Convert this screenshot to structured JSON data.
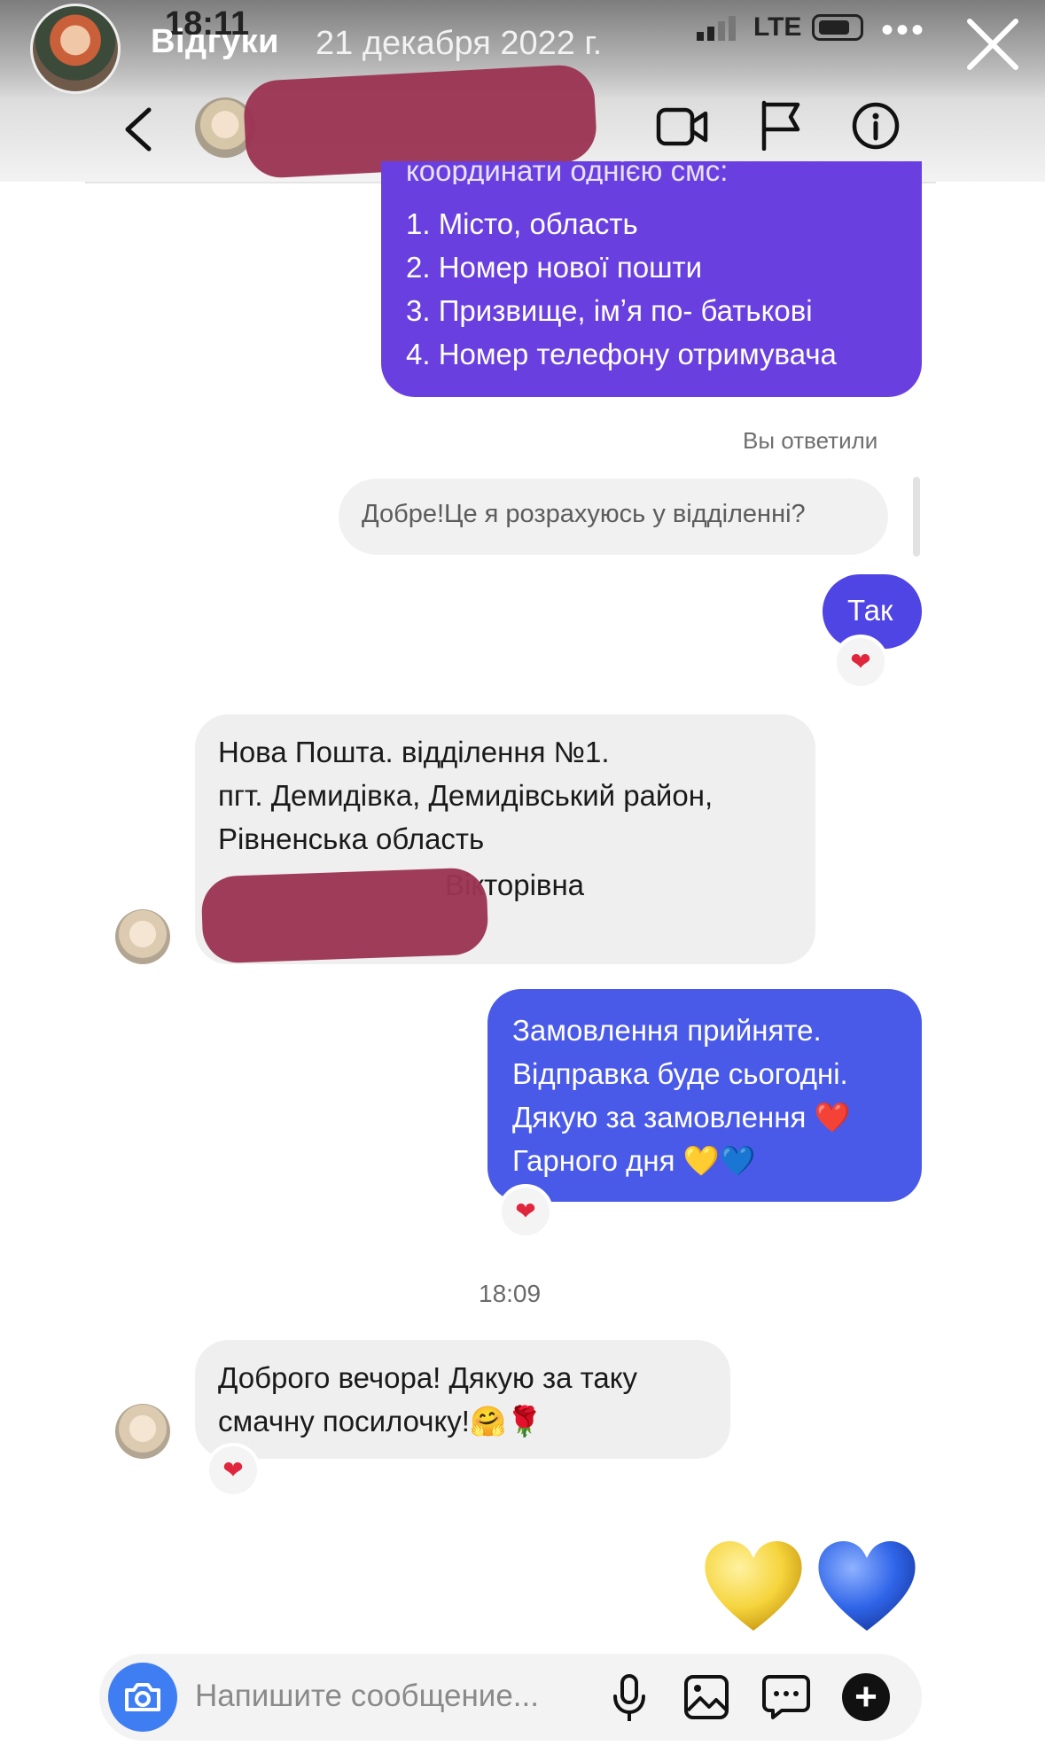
{
  "status_bar": {
    "time": "18:11",
    "network": "LTE"
  },
  "story": {
    "title": "Відгуки",
    "date": "21 декабря 2022 г.",
    "more": "•••"
  },
  "messages": {
    "outgoing_1_top_cut": "координати однією смс:",
    "outgoing_1": "1. Місто, область\n2. Номер нової пошти\n3. Призвище, імʼя по- батькові\n4. Номер телефону отримувача",
    "reply_meta": "Вы ответили",
    "replied_quote": "Добре!Це я розрахуюсь у відділенні?",
    "outgoing_2": "Так",
    "incoming_1": "Нова Пошта.  відділення №1.\nпгт. Демидівка, Демидівський район,\nРівненська область",
    "incoming_1_partial": "Вікторівна",
    "outgoing_3": "Замовлення прийняте.\nВідправка буде сьогодні.\nДякую за замовлення ❤️\nГарного дня 💛💙",
    "timestamp": "18:09",
    "incoming_2": "Доброго вечора! Дякую за таку\nсмачну посилочку!🤗🌹"
  },
  "reactions": {
    "heart": "❤"
  },
  "hearts": {
    "yellow": "#f7d84a",
    "blue": "#2f64e8"
  },
  "composer": {
    "placeholder": "Напишите сообщение..."
  },
  "icons": [
    "back-icon",
    "video-icon",
    "flag-icon",
    "info-icon",
    "camera-icon",
    "mic-icon",
    "gallery-icon",
    "sticker-icon",
    "plus-icon",
    "close-icon"
  ]
}
